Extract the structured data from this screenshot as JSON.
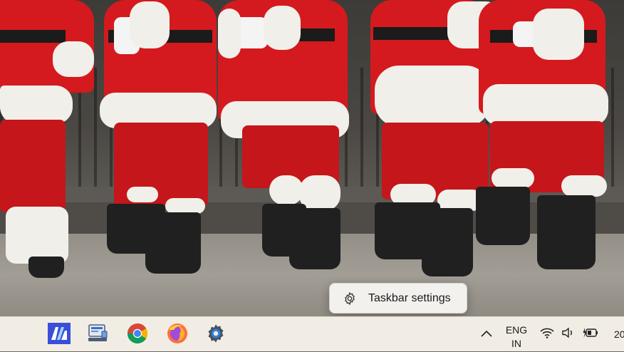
{
  "wallpaper": {
    "description_icon": "santa-crowd-wallpaper",
    "colors": {
      "suit_red": "#d41a1e",
      "fur_white": "#f1efe9",
      "boot_black": "#202020"
    }
  },
  "context_menu": {
    "items": [
      {
        "label": "Taskbar settings",
        "icon": "gear-icon"
      }
    ]
  },
  "taskbar": {
    "background": "#f1ede4",
    "pinned_apps": [
      {
        "name": "ma-app",
        "icon": "ma-logo-icon"
      },
      {
        "name": "computer-manager",
        "icon": "monitor-icon"
      },
      {
        "name": "chrome",
        "icon": "chrome-icon"
      },
      {
        "name": "firefox",
        "icon": "firefox-icon"
      },
      {
        "name": "settings",
        "icon": "gear-icon"
      }
    ],
    "tray": {
      "chevron_icon": "chevron-up-icon",
      "language_line1": "ENG",
      "language_line2": "IN",
      "wifi_icon": "wifi-icon",
      "volume_icon": "speaker-icon",
      "battery_icon": "battery-charging-icon",
      "clock_text": "20"
    }
  }
}
